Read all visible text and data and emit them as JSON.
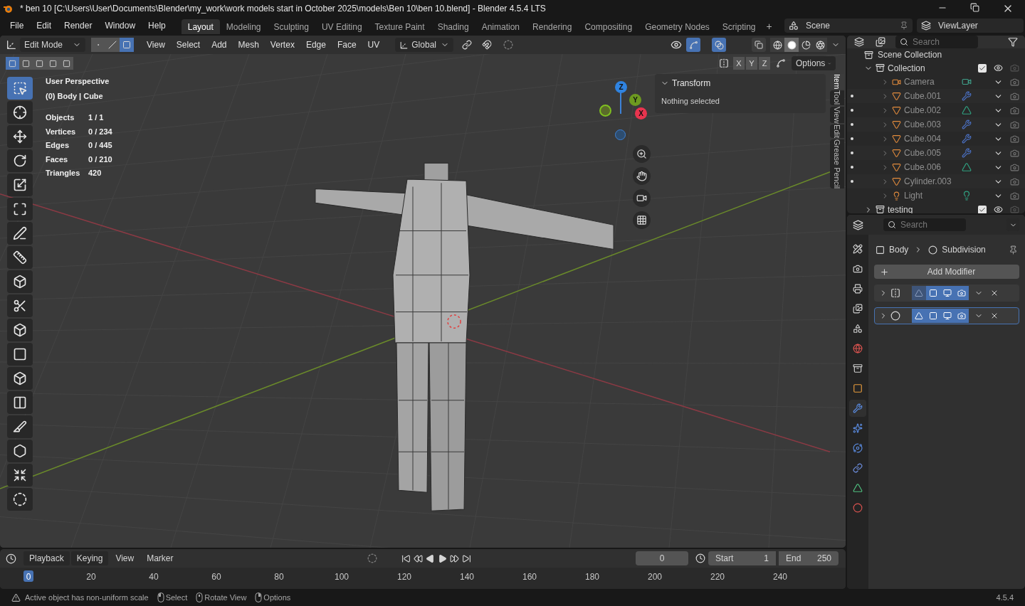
{
  "title_bar": {
    "title": "* ben 10 [C:\\Users\\User\\Documents\\Blender\\my_work\\work models start in October 2025\\models\\Ben 10\\ben 10.blend] - Blender 4.5.4 LTS"
  },
  "menu": [
    "File",
    "Edit",
    "Render",
    "Window",
    "Help"
  ],
  "workspaces": [
    {
      "label": "Layout",
      "selected": true
    },
    {
      "label": "Modeling",
      "selected": false
    },
    {
      "label": "Sculpting",
      "selected": false
    },
    {
      "label": "UV Editing",
      "selected": false
    },
    {
      "label": "Texture Paint",
      "selected": false
    },
    {
      "label": "Shading",
      "selected": false
    },
    {
      "label": "Animation",
      "selected": false
    },
    {
      "label": "Rendering",
      "selected": false
    },
    {
      "label": "Compositing",
      "selected": false
    },
    {
      "label": "Geometry Nodes",
      "selected": false
    },
    {
      "label": "Scripting",
      "selected": false
    }
  ],
  "add_workspace": "+",
  "scene": {
    "name": "Scene"
  },
  "view_layer": {
    "name": "ViewLayer"
  },
  "viewport": {
    "header": {
      "mode": "Edit Mode",
      "select_modes": [
        {
          "kind": "vertex",
          "selected": false
        },
        {
          "kind": "edge",
          "selected": false
        },
        {
          "kind": "face",
          "selected": true
        }
      ],
      "menus": [
        "View",
        "Select",
        "Add",
        "Mesh",
        "Vertex",
        "Edge",
        "Face",
        "UV"
      ],
      "orientation": "Global",
      "gizmos_on": true,
      "overlays_on": true,
      "xray_on": false,
      "shading": [
        {
          "kind": "wireframe",
          "selected": false
        },
        {
          "kind": "solid",
          "selected": true
        },
        {
          "kind": "material",
          "selected": false
        },
        {
          "kind": "rendered",
          "selected": false
        }
      ]
    },
    "tool_settings": {
      "box_modes": [
        {
          "selected": true
        },
        {
          "selected": false
        },
        {
          "selected": false
        },
        {
          "selected": false
        },
        {
          "selected": false
        }
      ],
      "axes": [
        "X",
        "Y",
        "Z"
      ],
      "options": "Options"
    },
    "overlay": {
      "view_name": "User Perspective",
      "object_info": "(0) Body | Cube",
      "stats": [
        {
          "label": "Objects",
          "value": "1 / 1"
        },
        {
          "label": "Vertices",
          "value": "0 / 234"
        },
        {
          "label": "Edges",
          "value": "0 / 445"
        },
        {
          "label": "Faces",
          "value": "0 / 210"
        },
        {
          "label": "Triangles",
          "value": "420"
        }
      ]
    },
    "tools": [
      {
        "kind": "select",
        "selected": true
      },
      {
        "kind": "cursor",
        "selected": false
      },
      {
        "kind": "move",
        "selected": false
      },
      {
        "kind": "rotate",
        "selected": false
      },
      {
        "kind": "scale",
        "selected": false
      },
      {
        "kind": "transform",
        "selected": false
      },
      {
        "kind": "annotate",
        "selected": false
      },
      {
        "kind": "measure",
        "selected": false
      },
      {
        "kind": "add-cube",
        "selected": false
      },
      {
        "kind": "cut-cube",
        "selected": false
      },
      {
        "kind": "extrude",
        "selected": false
      },
      {
        "kind": "inset",
        "selected": false
      },
      {
        "kind": "bevel",
        "selected": false
      },
      {
        "kind": "loop-cut",
        "selected": false
      },
      {
        "kind": "knife",
        "selected": false
      },
      {
        "kind": "poly-build",
        "selected": false
      },
      {
        "kind": "shrink",
        "selected": false
      },
      {
        "kind": "circle",
        "selected": false
      }
    ],
    "nav_axes": [
      {
        "label": "Z"
      },
      {
        "label": "Y"
      },
      {
        "label": "X"
      }
    ],
    "sidebar": {
      "panel": "Transform",
      "expanded": true,
      "message": "Nothing selected",
      "tabs": [
        {
          "label": "Item",
          "selected": true
        },
        {
          "label": "Tool",
          "selected": false
        },
        {
          "label": "View",
          "selected": false
        },
        {
          "label": "Edit",
          "selected": false
        },
        {
          "label": "Grease Pencil",
          "selected": false
        }
      ]
    }
  },
  "outliner": {
    "search": {
      "placeholder": "Search"
    },
    "root": "Scene Collection",
    "collections": [
      {
        "name": "Collection",
        "expanded": true,
        "checked": true,
        "children": [
          {
            "name": "Camera",
            "kind": "camera",
            "badge": {
              "kind": "camera"
            },
            "edit_dot": false
          },
          {
            "name": "Cube.001",
            "kind": "mesh",
            "badge": {
              "kind": "modifier"
            },
            "edit_dot": true
          },
          {
            "name": "Cube.002",
            "kind": "mesh",
            "badge": {
              "kind": "mesh"
            },
            "edit_dot": true
          },
          {
            "name": "Cube.003",
            "kind": "mesh",
            "badge": {
              "kind": "modifier"
            },
            "edit_dot": true
          },
          {
            "name": "Cube.004",
            "kind": "mesh",
            "badge": {
              "kind": "modifier"
            },
            "edit_dot": true
          },
          {
            "name": "Cube.005",
            "kind": "mesh",
            "badge": {
              "kind": "modifier"
            },
            "edit_dot": true
          },
          {
            "name": "Cube.006",
            "kind": "mesh",
            "badge": {
              "kind": "mesh"
            },
            "edit_dot": true
          },
          {
            "name": "Cylinder.003",
            "kind": "mesh",
            "edit_dot": true
          },
          {
            "name": "Light",
            "kind": "light",
            "badge": {
              "kind": "light"
            },
            "edit_dot": false
          }
        ]
      },
      {
        "name": "testing",
        "expanded": false,
        "checked": true
      }
    ]
  },
  "properties": {
    "search": {
      "placeholder": "Search"
    },
    "tabs": [
      {
        "kind": "tool",
        "selected": false
      },
      {
        "kind": "render",
        "selected": false
      },
      {
        "kind": "output",
        "selected": false
      },
      {
        "kind": "view-layer",
        "selected": false
      },
      {
        "kind": "scene",
        "selected": false
      },
      {
        "kind": "world",
        "selected": false
      },
      {
        "kind": "collection",
        "selected": false
      },
      {
        "kind": "object",
        "selected": false
      },
      {
        "kind": "modifier",
        "selected": true
      },
      {
        "kind": "particles",
        "selected": false
      },
      {
        "kind": "physics",
        "selected": false
      },
      {
        "kind": "constraints",
        "selected": false
      },
      {
        "kind": "data",
        "selected": false
      },
      {
        "kind": "material",
        "selected": false
      }
    ],
    "breadcrumb": {
      "object": "Body",
      "modifier": "Subdivision"
    },
    "add_button": "Add Modifier",
    "modifiers": [
      {
        "kind": "mirror",
        "active": false,
        "toggles": [
          {
            "kind": "edit",
            "on": false
          },
          {
            "kind": "cage",
            "on": true
          },
          {
            "kind": "viewport",
            "on": true
          },
          {
            "kind": "render",
            "on": true
          }
        ]
      },
      {
        "kind": "subdivision",
        "active": true,
        "toggles": [
          {
            "kind": "edit",
            "on": true
          },
          {
            "kind": "cage",
            "on": true
          },
          {
            "kind": "viewport",
            "on": true
          },
          {
            "kind": "render",
            "on": true
          }
        ]
      }
    ]
  },
  "timeline": {
    "menus": [
      "Playback",
      "Keying",
      "View",
      "Marker"
    ],
    "current_frame": "0",
    "start_label": "Start",
    "start": "1",
    "end_label": "End",
    "end": "250",
    "ruler": [
      {
        "label": "0",
        "selected": true
      },
      {
        "label": "20",
        "selected": false
      },
      {
        "label": "40",
        "selected": false
      },
      {
        "label": "60",
        "selected": false
      },
      {
        "label": "80",
        "selected": false
      },
      {
        "label": "100",
        "selected": false
      },
      {
        "label": "120",
        "selected": false
      },
      {
        "label": "140",
        "selected": false
      },
      {
        "label": "160",
        "selected": false
      },
      {
        "label": "180",
        "selected": false
      },
      {
        "label": "200",
        "selected": false
      },
      {
        "label": "220",
        "selected": false
      },
      {
        "label": "240",
        "selected": false
      }
    ]
  },
  "status_bar": {
    "warning": "Active object has non-uniform scale",
    "hints": [
      {
        "kind": "left",
        "label": "Select"
      },
      {
        "kind": "middle",
        "label": "Rotate View"
      },
      {
        "kind": "right",
        "label": "Options"
      }
    ],
    "version": "4.5.4"
  }
}
